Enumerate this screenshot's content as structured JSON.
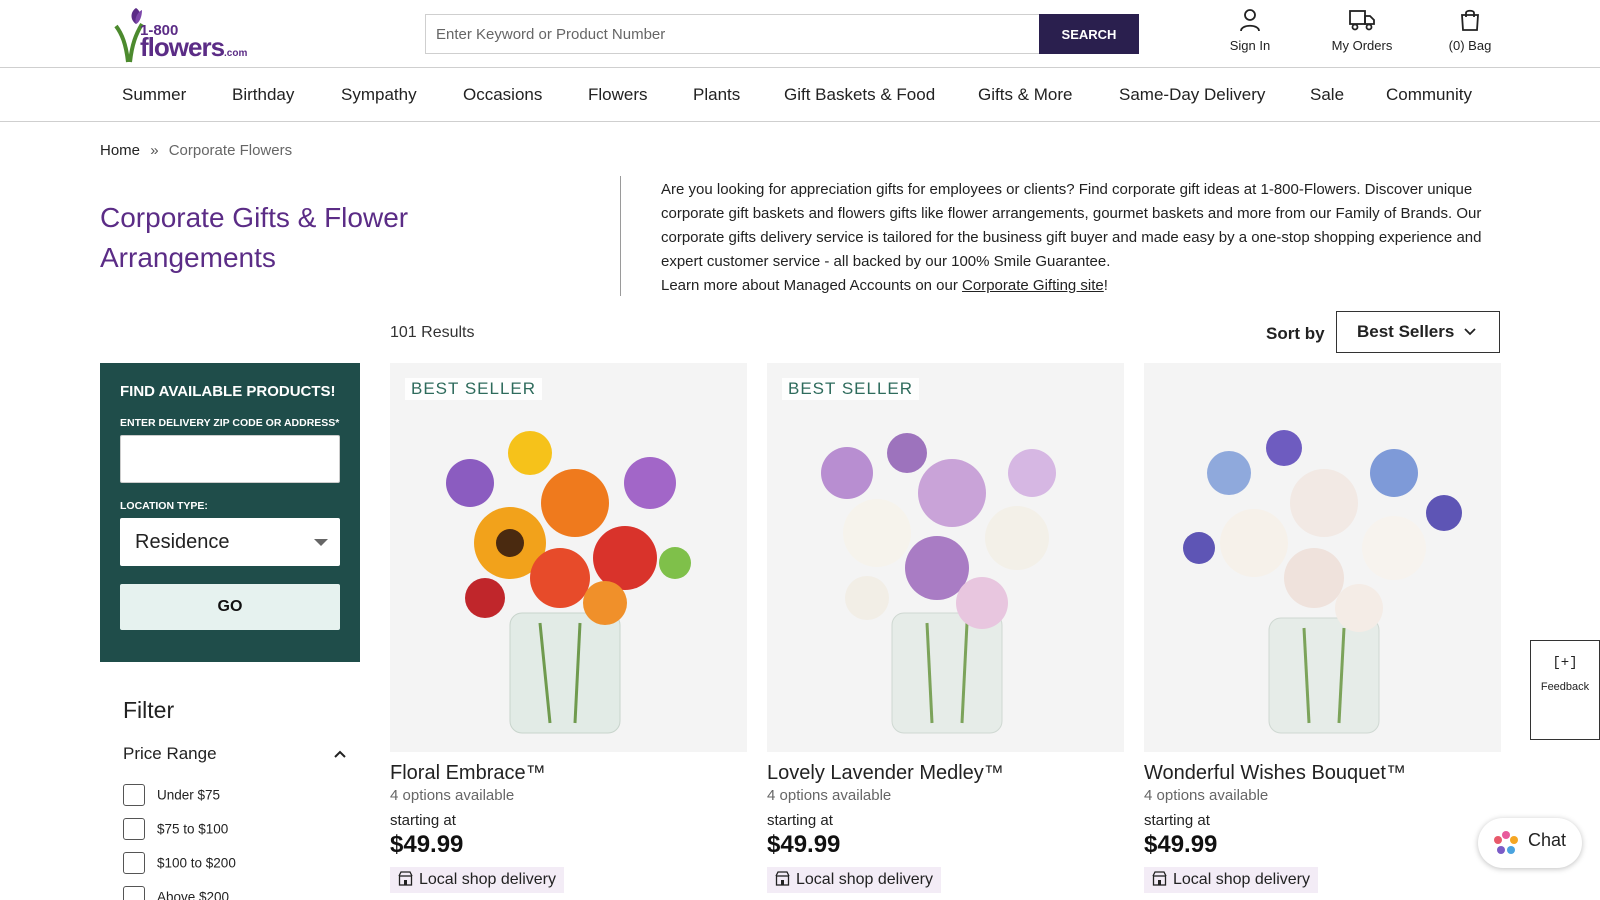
{
  "header": {
    "logo_number": "1-800",
    "logo_word": "flowers",
    "logo_com": ".com",
    "search_placeholder": "Enter Keyword or Product Number",
    "search_button": "SEARCH",
    "sign_in": "Sign In",
    "my_orders": "My Orders",
    "bag": "(0) Bag"
  },
  "nav": {
    "items": [
      "Summer",
      "Birthday",
      "Sympathy",
      "Occasions",
      "Flowers",
      "Plants",
      "Gift Baskets & Food",
      "Gifts & More",
      "Same-Day Delivery",
      "Sale",
      "Community"
    ]
  },
  "breadcrumb": {
    "home": "Home",
    "separator": "»",
    "current": "Corporate Flowers"
  },
  "page": {
    "title": "Corporate Gifts & Flower Arrangements",
    "intro": "Are you looking for appreciation gifts for employees or clients? Find corporate gift ideas at 1-800-Flowers. Discover unique corporate gift baskets and flowers gifts like flower arrangements, gourmet baskets and more from our Family of Brands. Our corporate gifts delivery service is tailored for the business gift buyer and made easy by a one-stop shopping experience and expert customer service - all backed by our 100% Smile Guarantee.",
    "intro_learn": "Learn more about Managed Accounts on our ",
    "intro_link": "Corporate Gifting site",
    "intro_end": "!",
    "results": "101 Results",
    "sort_label": "Sort by",
    "sort_value": "Best Sellers"
  },
  "finder": {
    "title": "FIND AVAILABLE PRODUCTS!",
    "zip_label": "ENTER DELIVERY ZIP CODE OR ADDRESS*",
    "location_label": "LOCATION TYPE:",
    "location_value": "Residence",
    "go": "GO"
  },
  "filter": {
    "title": "Filter",
    "price_range": "Price Range",
    "options": [
      "Under $75",
      "$75 to $100",
      "$100 to $200",
      "Above $200"
    ]
  },
  "products": [
    {
      "badge": "BEST SELLER",
      "name": "Floral Embrace™",
      "options": "4 options available",
      "starting": "starting at",
      "price": "$49.99",
      "delivery": "Local shop delivery"
    },
    {
      "badge": "BEST SELLER",
      "name": "Lovely Lavender Medley™",
      "options": "4 options available",
      "starting": "starting at",
      "price": "$49.99",
      "delivery": "Local shop delivery"
    },
    {
      "badge": "",
      "name": "Wonderful Wishes Bouquet™",
      "options": "4 options available",
      "starting": "starting at",
      "price": "$49.99",
      "delivery": "Local shop delivery"
    }
  ],
  "widgets": {
    "feedback_icon": "[+]",
    "feedback": "Feedback",
    "chat": "Chat"
  },
  "colors": {
    "brand_purple": "#5b2c86",
    "search_button": "#2a1f4e",
    "finder_panel": "#1f4d4a",
    "badge_text": "#2e6b5c"
  }
}
